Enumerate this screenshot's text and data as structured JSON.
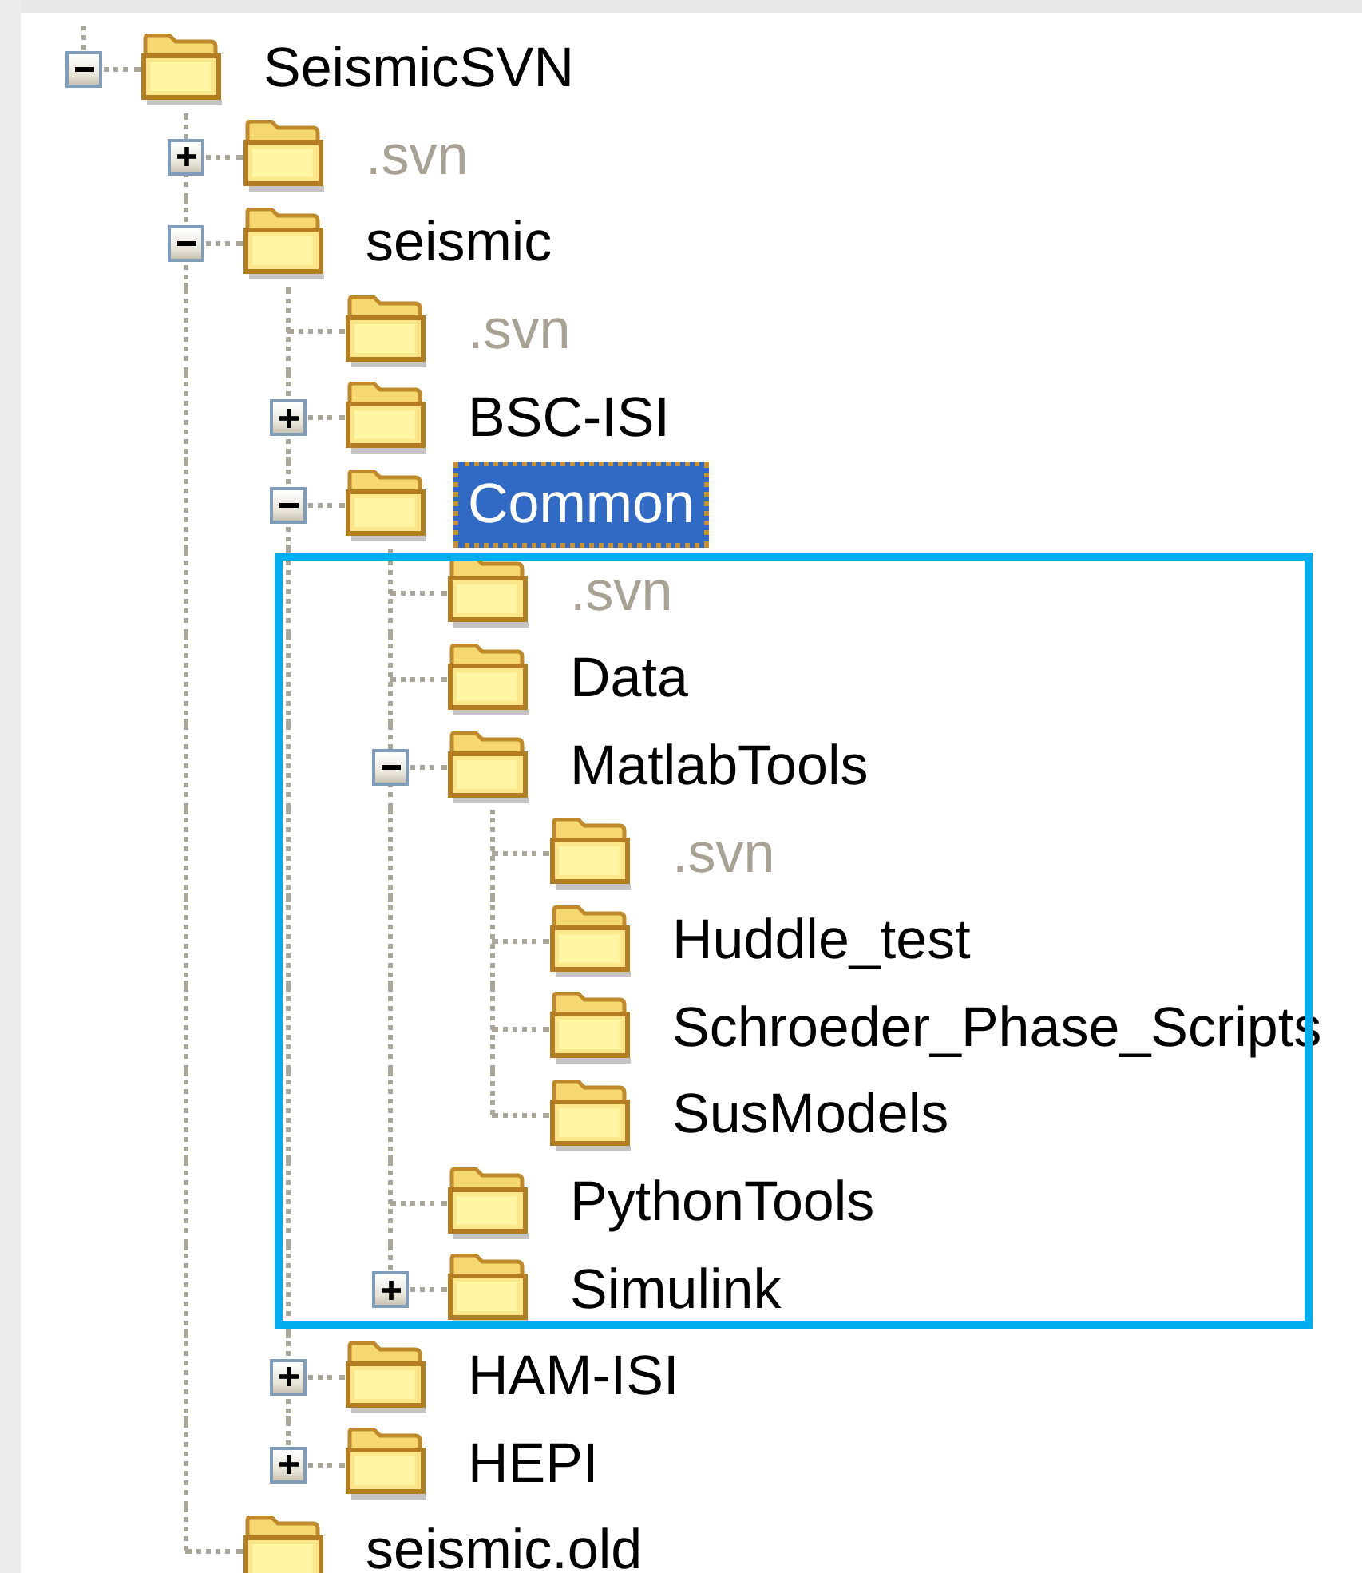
{
  "tree": [
    {
      "label": "SeismicSVN",
      "dimmed": false,
      "selected": false,
      "kind": "branch",
      "expanded": true,
      "children": [
        {
          "label": ".svn",
          "dimmed": true,
          "selected": false,
          "kind": "branch",
          "expanded": false
        },
        {
          "label": "seismic",
          "dimmed": false,
          "selected": false,
          "kind": "branch",
          "expanded": true,
          "children": [
            {
              "label": ".svn",
              "dimmed": true,
              "selected": false,
              "kind": "leaf"
            },
            {
              "label": "BSC-ISI",
              "dimmed": false,
              "selected": false,
              "kind": "branch",
              "expanded": false
            },
            {
              "label": "Common",
              "dimmed": false,
              "selected": true,
              "kind": "branch",
              "expanded": true,
              "framed": true,
              "children": [
                {
                  "label": ".svn",
                  "dimmed": true,
                  "selected": false,
                  "kind": "leaf"
                },
                {
                  "label": "Data",
                  "dimmed": false,
                  "selected": false,
                  "kind": "leaf"
                },
                {
                  "label": "MatlabTools",
                  "dimmed": false,
                  "selected": false,
                  "kind": "branch",
                  "expanded": true,
                  "children": [
                    {
                      "label": ".svn",
                      "dimmed": true,
                      "selected": false,
                      "kind": "leaf"
                    },
                    {
                      "label": "Huddle_test",
                      "dimmed": false,
                      "selected": false,
                      "kind": "leaf"
                    },
                    {
                      "label": "Schroeder_Phase_Scripts",
                      "dimmed": false,
                      "selected": false,
                      "kind": "leaf"
                    },
                    {
                      "label": "SusModels",
                      "dimmed": false,
                      "selected": false,
                      "kind": "leaf"
                    }
                  ]
                },
                {
                  "label": "PythonTools",
                  "dimmed": false,
                  "selected": false,
                  "kind": "leaf"
                },
                {
                  "label": "Simulink",
                  "dimmed": false,
                  "selected": false,
                  "kind": "branch",
                  "expanded": false
                }
              ]
            },
            {
              "label": "HAM-ISI",
              "dimmed": false,
              "selected": false,
              "kind": "branch",
              "expanded": false
            },
            {
              "label": "HEPI",
              "dimmed": false,
              "selected": false,
              "kind": "branch",
              "expanded": false
            }
          ]
        },
        {
          "label": "seismic.old",
          "dimmed": false,
          "selected": false,
          "kind": "leaf"
        }
      ]
    }
  ]
}
